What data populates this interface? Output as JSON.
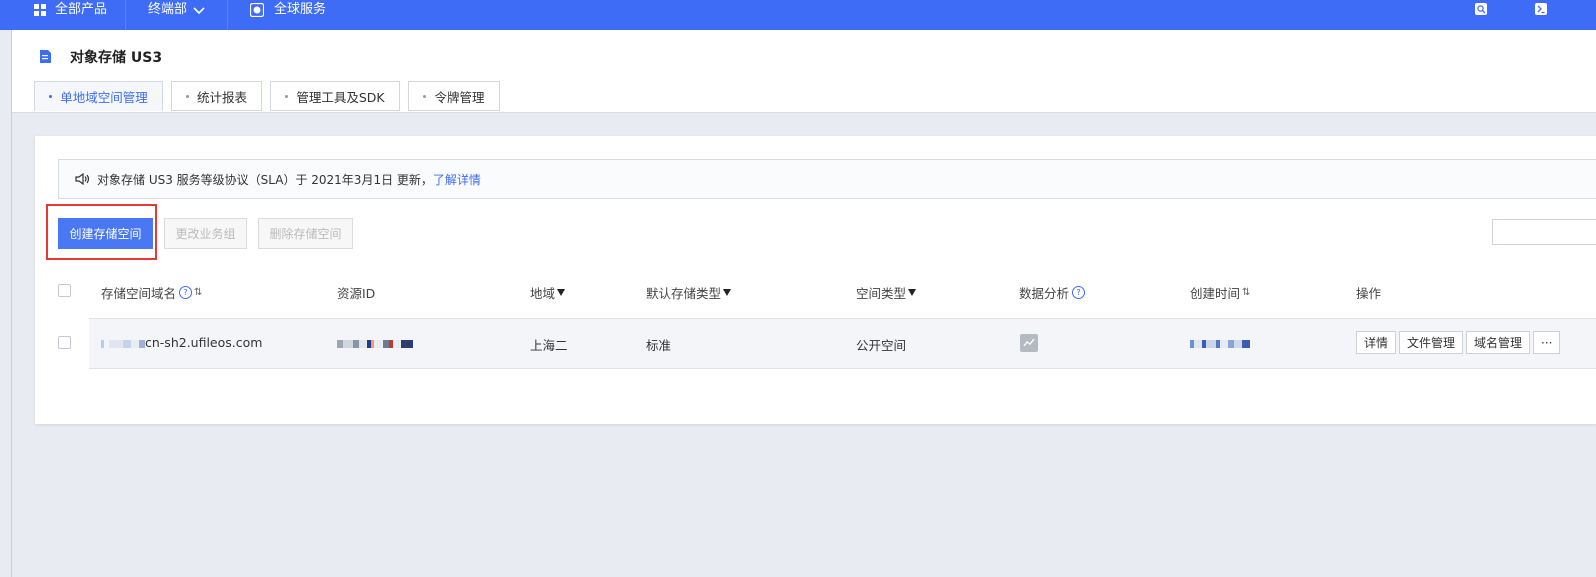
{
  "topbar": {
    "all_products": "全部产品",
    "terminal": "终端部",
    "global_services": "全球服务"
  },
  "page": {
    "title": "对象存储 US3"
  },
  "tabs": [
    {
      "label": "单地域空间管理",
      "active": true
    },
    {
      "label": "统计报表"
    },
    {
      "label": "管理工具及SDK"
    },
    {
      "label": "令牌管理"
    }
  ],
  "notice": {
    "text": "对象存储 US3 服务等级协议（SLA）于 2021年3月1日 更新，",
    "link": "了解详情"
  },
  "toolbar": {
    "create_label": "创建存储空间",
    "change_group_label": "更改业务组",
    "delete_label": "删除存储空间"
  },
  "table": {
    "headers": {
      "domain": "存储空间域名",
      "resource_id": "资源ID",
      "region": "地域",
      "storage_type": "默认存储类型",
      "space_type": "空间类型",
      "analysis": "数据分析",
      "created": "创建时间",
      "ops": "操作"
    },
    "rows": [
      {
        "domain_suffix": "cn-sh2.ufileos.com",
        "region": "上海二",
        "storage_type": "标准",
        "space_type": "公开空间",
        "ops": [
          "详情",
          "文件管理",
          "域名管理",
          "···"
        ]
      }
    ]
  },
  "colors": {
    "brand": "#3e6cf6",
    "highlight": "#e53935"
  }
}
